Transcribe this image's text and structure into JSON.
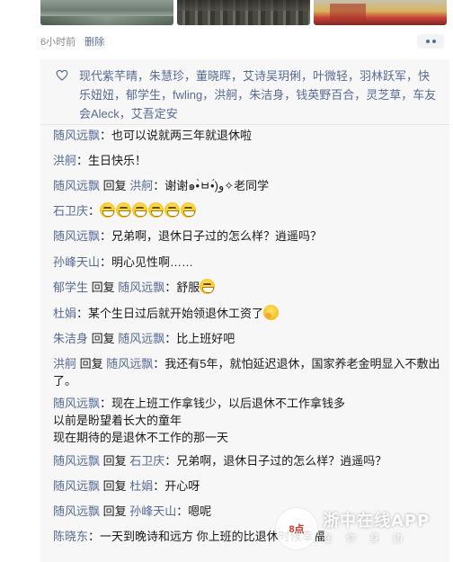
{
  "post": {
    "photos": [
      "photo-lake",
      "photo-rooftops",
      "photo-temple"
    ],
    "time": "6小时前",
    "delete_label": "删除",
    "more_icon": "more-dots-icon",
    "accent_color": "#576b95"
  },
  "likes": {
    "icon": "heart-outline-icon",
    "names_text": "现代紫芊晴，朱慧珍，董晓晖，艾诗吴玥俐，叶微轻，羽林跃军，快乐妞妞，郁学生，fwling，洪舸，朱洁身，钱英野百合，灵芝草，车友会Aleck，艾吾定安"
  },
  "comments": [
    {
      "author": "随风远飘",
      "reply_to": "",
      "text": "：也可以说就两三年就退休啦"
    },
    {
      "author": "洪舸",
      "reply_to": "",
      "text": "：生日快乐！"
    },
    {
      "author": "随风远飘",
      "reply_to": "洪舸",
      "text": "：谢谢๑•̀ㅂ•́)و✧老同学"
    },
    {
      "author": "石卫庆",
      "reply_to": "",
      "text": "：",
      "emoji_count": 6,
      "emoji": "grin-emoji"
    },
    {
      "author": "随风远飘",
      "reply_to": "",
      "text": "：兄弟啊，退休日子过的怎么样？逍遥吗？"
    },
    {
      "author": "孙峰天山",
      "reply_to": "",
      "text": "：明心见性啊……"
    },
    {
      "author": "郁学生",
      "reply_to": "随风远飘",
      "text": "：舒服",
      "emoji_count": 1,
      "emoji": "grin-emoji"
    },
    {
      "author": "杜娟",
      "reply_to": "",
      "text": "：某个生日过后就开始领退休工资了",
      "emoji_count": 1,
      "emoji": "thinking-emoji"
    },
    {
      "author": "朱洁身",
      "reply_to": "随风远飘",
      "text": "：比上班好吧"
    },
    {
      "author": "洪舸",
      "reply_to": "随风远飘",
      "text": "：我还有5年，就怕延迟退休，国家养老金明显入不敷出了。"
    },
    {
      "author": "随风远飘",
      "reply_to": "",
      "text": "：现在上班工作拿钱少，以后退休不工作拿钱多\n以前是盼望着长大的童年\n现在期待的是退休不工作的那一天"
    },
    {
      "author": "随风远飘",
      "reply_to": "石卫庆",
      "text": "：兄弟啊，退休日子过的怎么样？逍遥吗？"
    },
    {
      "author": "随风远飘",
      "reply_to": "杜娟",
      "text": "：开心呀"
    },
    {
      "author": "随风远飘",
      "reply_to": "孙峰天山",
      "text": "：嗯呢"
    },
    {
      "author": "陈晓东",
      "reply_to": "",
      "text": "：一天到晚诗和远方 你上班的比退休时候幸福"
    }
  ],
  "reply_word": "回复",
  "watermark": {
    "logo_text": "8点",
    "title": "浙中在线APP",
    "subtitle": "在你身边"
  }
}
